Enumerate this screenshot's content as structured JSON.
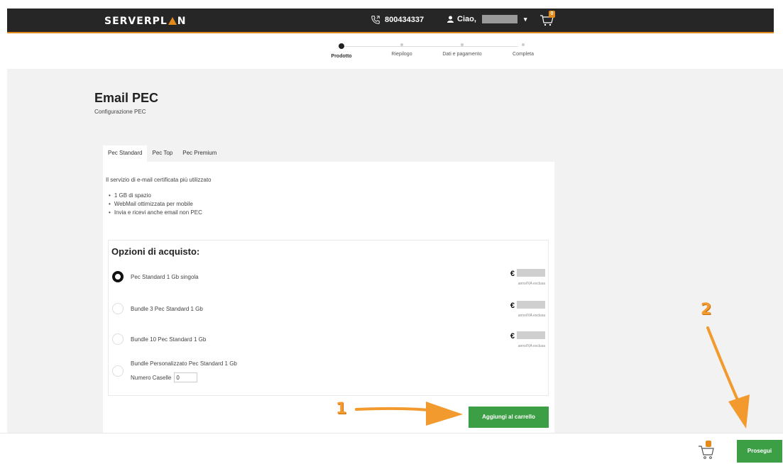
{
  "header": {
    "logo_server": "SERVER",
    "logo_plan_a": "PL",
    "logo_plan_b": "N",
    "phone": "800434337",
    "user_greeting": "Ciao,",
    "cart_count": "0",
    "colors": {
      "bar": "#262626",
      "accent": "#e38a1a"
    }
  },
  "steps": [
    {
      "label": "Prodotto",
      "active": true
    },
    {
      "label": "Riepilogo",
      "active": false
    },
    {
      "label": "Dati e pagamento",
      "active": false
    },
    {
      "label": "Completa",
      "active": false
    }
  ],
  "page": {
    "title": "Email PEC",
    "subtitle": "Configurazione PEC"
  },
  "tabs": [
    {
      "label": "Pec Standard",
      "active": true
    },
    {
      "label": "Pec Top",
      "active": false
    },
    {
      "label": "Pec Premium",
      "active": false
    }
  ],
  "product": {
    "description": "Il servizio di e-mail certificata più utilizzato",
    "features": [
      "1 GB di spazio",
      "WebMail ottimizzata per mobile",
      "Invia e ricevi anche email non PEC"
    ]
  },
  "purchase": {
    "heading": "Opzioni di acquisto:",
    "currency": "€",
    "price_note": "anno/IVA esclusa",
    "options": [
      {
        "label": "Pec Standard 1 Gb singola",
        "selected": true
      },
      {
        "label": "Bundle 3 Pec Standard 1 Gb",
        "selected": false
      },
      {
        "label": "Bundle 10 Pec Standard 1 Gb",
        "selected": false
      },
      {
        "label": "Bundle Personalizzato Pec Standard 1 Gb",
        "selected": false
      }
    ],
    "count_label": "Numero Caselle",
    "count_value": "0",
    "add_to_cart": "Aggiungi al carrello"
  },
  "footer": {
    "continue": "Prosegui",
    "button_color": "#3d9f45"
  },
  "annotations": {
    "one": "1",
    "two": "2",
    "color": "#f29a2e"
  }
}
